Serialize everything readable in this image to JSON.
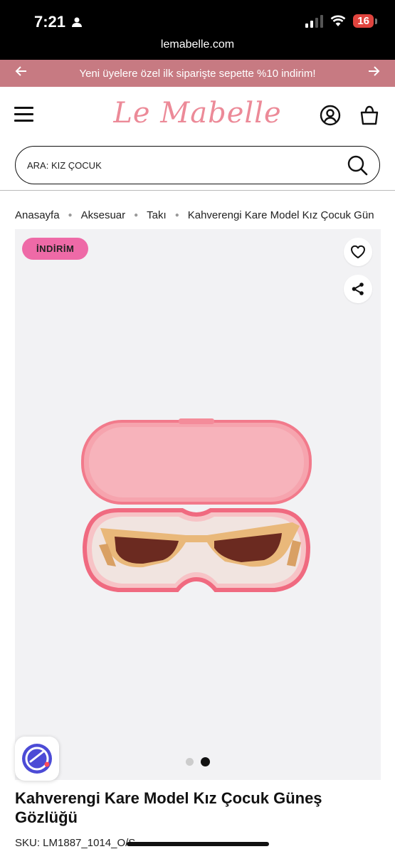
{
  "status_bar": {
    "time": "7:21",
    "battery": "16",
    "url": "lemabelle.com"
  },
  "promo": {
    "text": "Yeni üyelere özel ilk siparişte sepette %10 indirim!"
  },
  "header": {
    "logo": "Le Mabelle"
  },
  "search": {
    "placeholder": "ARA: KIZ ÇOCUK"
  },
  "breadcrumb": [
    "Anasayfa",
    "Aksesuar",
    "Takı",
    "Kahverengi Kare Model Kız Çocuk Gün"
  ],
  "product": {
    "badge": "İNDİRİM",
    "title": "Kahverengi Kare Model Kız Çocuk Güneş Gözlüğü",
    "sku": "SKU: LM1887_1014_O/S",
    "image_count": 2,
    "active_image": 2
  },
  "colors": {
    "promo_bg": "#c77a82",
    "logo": "#ec8a98",
    "badge_bg": "#ee6aa7",
    "case_pink": "#f47a8a",
    "frame_tan": "#e9b87a"
  },
  "icons": {
    "menu": "hamburger-icon",
    "account": "user-icon",
    "cart": "shopping-bag-icon",
    "search": "search-icon",
    "wishlist": "heart-icon",
    "share": "share-icon"
  }
}
